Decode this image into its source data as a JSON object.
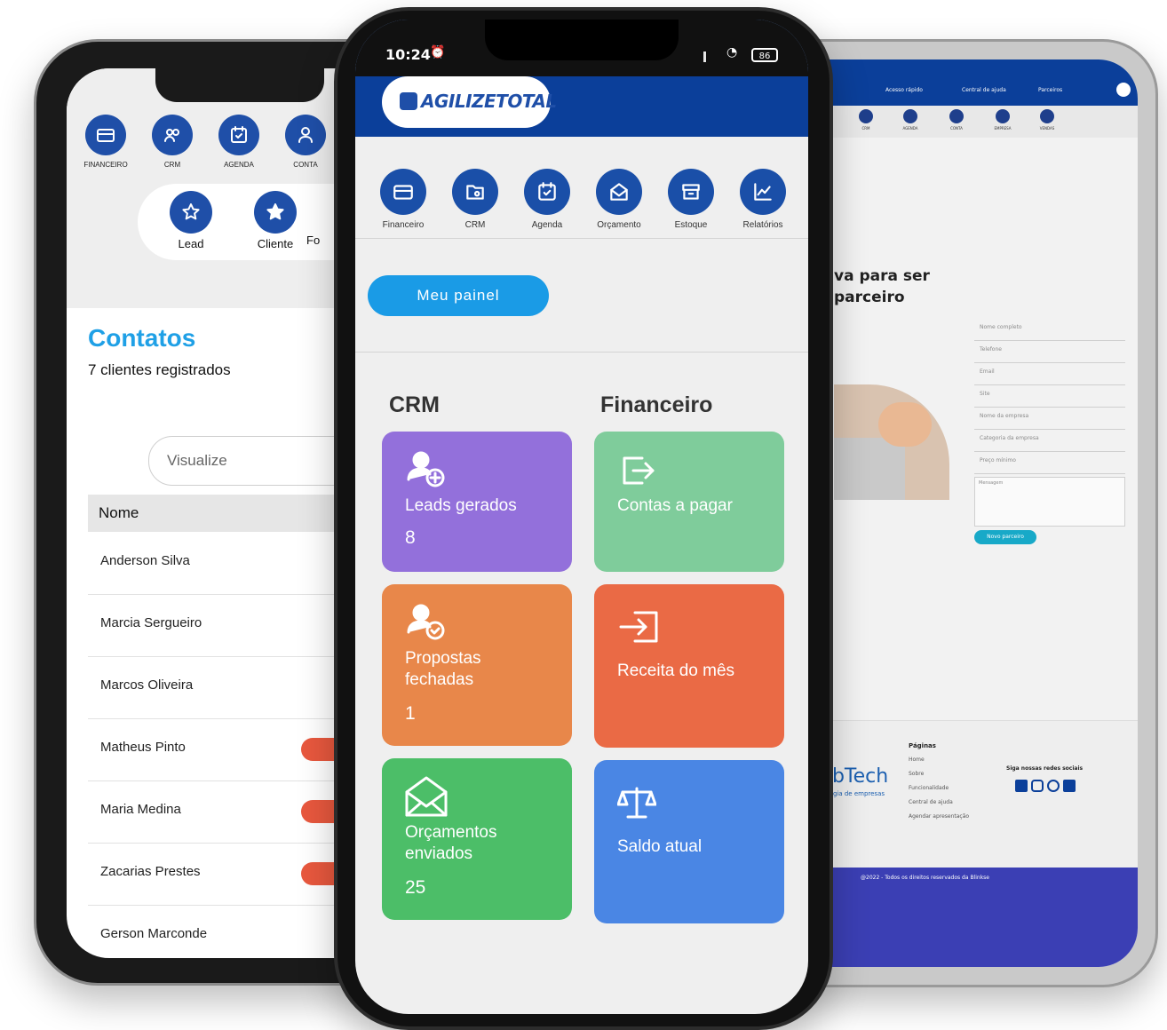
{
  "left_phone": {
    "nav": [
      {
        "label": "FINANCEIRO",
        "icon": "card-icon"
      },
      {
        "label": "CRM",
        "icon": "users-icon"
      },
      {
        "label": "AGENDA",
        "icon": "calendar-icon"
      },
      {
        "label": "CONTA",
        "icon": "user-icon"
      }
    ],
    "pills": [
      {
        "label": "Lead",
        "icon": "star-outline-icon"
      },
      {
        "label": "Cliente",
        "icon": "star-icon"
      },
      {
        "label": "Fo",
        "icon": ""
      }
    ],
    "title": "Contatos",
    "subtitle": "7 clientes registrados",
    "search_placeholder": "Visualize",
    "table_header": "Nome",
    "rows": [
      "Anderson Silva",
      "Marcia Sergueiro",
      "Marcos Oliveira",
      "Matheus Pinto",
      "Maria Medina",
      "Zacarias Prestes",
      "Gerson Marconde"
    ],
    "badge_color": "#e8583e",
    "accent": "#1fa0e6"
  },
  "center_phone": {
    "status": {
      "time": "10:24",
      "battery": "86"
    },
    "logo": "AGILIZETOTAL",
    "nav": [
      {
        "label": "Financeiro",
        "icon": "card-icon"
      },
      {
        "label": "CRM",
        "icon": "folder-icon"
      },
      {
        "label": "Agenda",
        "icon": "calendar-icon"
      },
      {
        "label": "Orçamento",
        "icon": "mail-open-icon"
      },
      {
        "label": "Estoque",
        "icon": "archive-icon"
      },
      {
        "label": "Relatórios",
        "icon": "chart-icon"
      }
    ],
    "panel_button": "Meu painel",
    "section_crm": "CRM",
    "section_fin": "Financeiro",
    "cards": {
      "leads": {
        "title": "Leads gerados",
        "value": "8",
        "color": "#9370db"
      },
      "contas": {
        "title": "Contas a pagar",
        "value": "",
        "color": "#7fcc9b"
      },
      "propostas": {
        "title1": "Propostas",
        "title2": "fechadas",
        "value": "1",
        "color": "#e8874a"
      },
      "receita": {
        "title": "Receita do mês",
        "value": "",
        "color": "#ea6a45"
      },
      "orcamentos": {
        "title1": "Orçamentos",
        "title2": "enviados",
        "value": "25",
        "color": "#4cbe68"
      },
      "saldo": {
        "title": "Saldo atual",
        "value": "",
        "color": "#4a86e4"
      }
    },
    "header_color": "#0b3f9a",
    "button_color": "#1a9be6"
  },
  "right_device": {
    "top_links": [
      "Acesso rápido",
      "Central de ajuda",
      "Parceiros"
    ],
    "nav": [
      "CRM",
      "AGENDA",
      "CONTA",
      "EMPRESA",
      "VENDAS"
    ],
    "heading1": "va para ser",
    "heading2": "parceiro",
    "form_fields": [
      "Nome completo",
      "Telefone",
      "Email",
      "Site",
      "Nome da empresa",
      "Categoria da empresa",
      "Preço mínimo"
    ],
    "message_placeholder": "Mensagem",
    "submit": "Novo parceiro",
    "footer_pages_title": "Páginas",
    "footer_pages": [
      "Home",
      "Sobre",
      "Funcionalidade",
      "Central de ajuda",
      "Agendar apresentação"
    ],
    "brand": "ubTech",
    "brand_sub": "nologia de empresas",
    "social_title": "Siga nossas redes sociais",
    "copyright": "@2022 - Todos os direitos reservados da Blinkse"
  }
}
